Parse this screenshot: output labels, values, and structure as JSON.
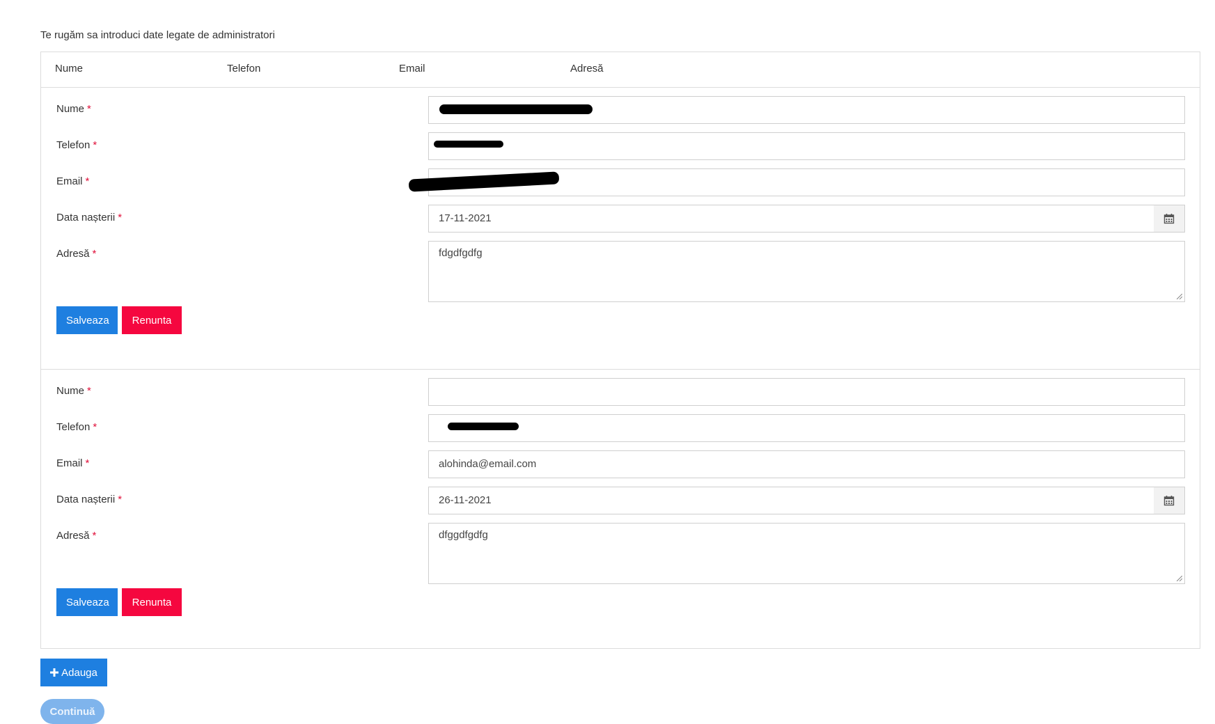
{
  "intro_text": "Te rugăm sa introduci date legate de administratori",
  "table_headers": [
    "Nume",
    "Telefon",
    "Email",
    "Adresă"
  ],
  "labels": {
    "name": "Nume",
    "phone": "Telefon",
    "email": "Email",
    "birth": "Data nașterii",
    "address": "Adresă",
    "required_mark": "*"
  },
  "forms": [
    {
      "name_value": "",
      "phone_value": "",
      "email_value": "",
      "birth_value": "17-11-2021",
      "address_value": "fdgdfgdfg"
    },
    {
      "name_value": "",
      "phone_value": "",
      "email_value": "alohinda@email.com",
      "birth_value": "26-11-2021",
      "address_value": "dfggdfgdfg"
    }
  ],
  "buttons": {
    "save": "Salveaza",
    "cancel": "Renunta",
    "add": "Adauga",
    "continue": "Continuă"
  },
  "colors": {
    "primary": "#1e7fe0",
    "danger": "#f5073f",
    "disabled": "#7fb4ec"
  }
}
